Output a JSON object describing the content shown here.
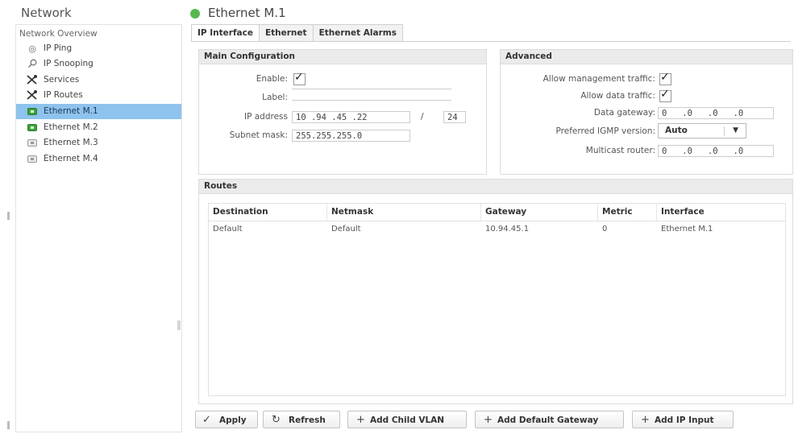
{
  "sidebar": {
    "title": "Network",
    "overview": "Network Overview",
    "items": [
      {
        "label": "IP Ping",
        "icon": "ping-icon"
      },
      {
        "label": "IP Snooping",
        "icon": "magnifier-icon"
      },
      {
        "label": "Services",
        "icon": "tools-icon"
      },
      {
        "label": "IP Routes",
        "icon": "tools-icon"
      },
      {
        "label": "Ethernet M.1",
        "icon": "ethernet-port-icon",
        "selected": true
      },
      {
        "label": "Ethernet M.2",
        "icon": "ethernet-port-icon"
      },
      {
        "label": "Ethernet M.3",
        "icon": "ethernet-port-icon"
      },
      {
        "label": "Ethernet M.4",
        "icon": "ethernet-port-icon"
      }
    ]
  },
  "header": {
    "title": "Ethernet M.1",
    "status_color": "#57b84f"
  },
  "tabs": [
    "IP Interface",
    "Ethernet",
    "Ethernet Alarms"
  ],
  "main_config": {
    "title": "Main Configuration",
    "enable_label": "Enable:",
    "label_label": "Label:",
    "label_value": "",
    "ip_label": "IP address",
    "ip_value": "10 .94 .45 .22",
    "prefix_sep": "/",
    "prefix_value": "24",
    "subnet_label": "Subnet mask:",
    "subnet_value": "255.255.255.0"
  },
  "advanced": {
    "title": "Advanced",
    "mgmt_label": "Allow management traffic:",
    "data_label": "Allow data traffic:",
    "gateway_label": "Data gateway:",
    "gateway_value": "0   .0   .0   .0",
    "igmp_label": "Preferred IGMP version:",
    "igmp_value": "Auto",
    "mcast_label": "Multicast router:",
    "mcast_value": "0   .0   .0   .0"
  },
  "routes": {
    "title": "Routes",
    "columns": [
      "Destination",
      "Netmask",
      "Gateway",
      "Metric",
      "Interface"
    ],
    "rows": [
      [
        "Default",
        "Default",
        "10.94.45.1",
        "0",
        "Ethernet M.1"
      ]
    ]
  },
  "buttons": {
    "apply": "Apply",
    "refresh": "Refresh",
    "add_child_vlan": "Add Child VLAN",
    "add_default_gateway": "Add Default Gateway",
    "add_ip_input": "Add IP Input"
  }
}
